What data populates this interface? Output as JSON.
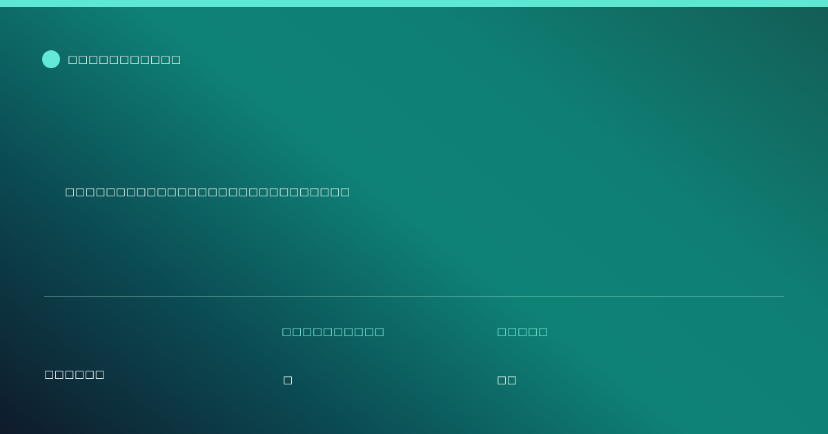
{
  "brand": {
    "icon": "circle-dot",
    "text": "□□□□□□□□□□□"
  },
  "headline": "□□□□□□□□□□□□□□□□□□□□□□□□□□□□",
  "footer": {
    "left_text": "□□□□□□",
    "stats": [
      {
        "label": "□□□□□□□□□□",
        "value": "□"
      },
      {
        "label": "□□□□□",
        "value": "□□"
      }
    ]
  },
  "colors": {
    "accent": "#5ee8d4",
    "background_dark": "#0f1a2b",
    "background_teal": "#0f8276"
  }
}
